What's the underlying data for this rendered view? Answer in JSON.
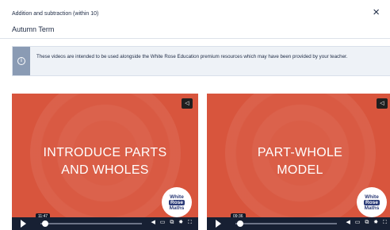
{
  "header": {
    "breadcrumb": "Addition and subtraction (within 10)",
    "term": "Autumn Term",
    "close_icon": "×"
  },
  "notice": {
    "icon": "info-icon",
    "text": "These videos are intended to be used alongside the White Rose Education premium resources which may have been provided by your teacher."
  },
  "videos": [
    {
      "title_line1": "INTRODUCE PARTS",
      "title_line2": "AND WHOLES",
      "timecode": "11:47",
      "brand_top": "White",
      "brand_mid": "Rose",
      "brand_bottom": "Maths"
    },
    {
      "title_line1": "PART-WHOLE",
      "title_line2": "MODEL",
      "timecode": "09:36",
      "brand_top": "White",
      "brand_mid": "Rose",
      "brand_bottom": "Maths"
    }
  ],
  "colors": {
    "video_bg": "#d8553d",
    "controls_bg": "#172033",
    "brand": "#2a3a77",
    "notice_bg": "#eef2f7",
    "notice_icon_bg": "#8a9bb4"
  }
}
